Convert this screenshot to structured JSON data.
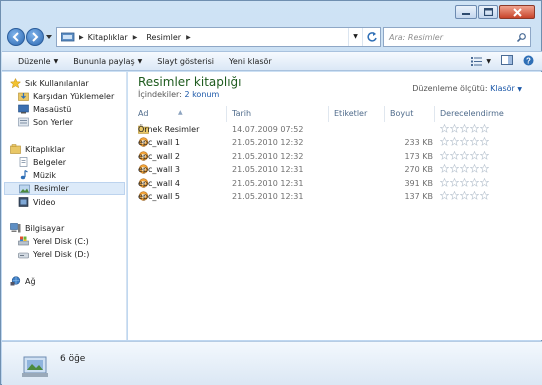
{
  "window": {
    "title": ""
  },
  "address": {
    "crumbs": [
      "Kitaplıklar",
      "Resimler"
    ],
    "search_placeholder": "Ara: Resimler"
  },
  "toolbar": {
    "organize": "Düzenle",
    "share": "Bununla paylaş",
    "slideshow": "Slayt gösterisi",
    "new_folder": "Yeni klasör"
  },
  "sidebar": {
    "favorites_header": "Sık Kullanılanlar",
    "favorites": [
      "Karşıdan Yüklemeler",
      "Masaüstü",
      "Son Yerler"
    ],
    "libraries_header": "Kitaplıklar",
    "libraries": [
      "Belgeler",
      "Müzik",
      "Resimler",
      "Video"
    ],
    "computer_header": "Bilgisayar",
    "drives": [
      "Yerel Disk (C:)",
      "Yerel Disk (D:)"
    ],
    "network": "Ağ"
  },
  "library": {
    "title": "Resimler kitaplığı",
    "includes_label": "İçindekiler:",
    "includes_link": "2 konum",
    "arrange_label": "Düzenleme ölçütü:",
    "arrange_value": "Klasör"
  },
  "columns": [
    "Ad",
    "Tarih",
    "Etiketler",
    "Boyut",
    "Derecelendirme"
  ],
  "files": [
    {
      "name": "Örnek Resimler",
      "date": "14.07.2009 07:52",
      "size": "",
      "type": "folder",
      "rating": 0
    },
    {
      "name": "epc_wall 1",
      "date": "21.05.2010 12:32",
      "size": "233 KB",
      "type": "image",
      "rating": 0
    },
    {
      "name": "epc_wall 2",
      "date": "21.05.2010 12:32",
      "size": "173 KB",
      "type": "image",
      "rating": 0
    },
    {
      "name": "epc_wall 3",
      "date": "21.05.2010 12:31",
      "size": "270 KB",
      "type": "image",
      "rating": 0
    },
    {
      "name": "epc_wall 4",
      "date": "21.05.2010 12:31",
      "size": "391 KB",
      "type": "image",
      "rating": 0
    },
    {
      "name": "epc_wall 5",
      "date": "21.05.2010 12:31",
      "size": "137 KB",
      "type": "image",
      "rating": 0
    }
  ],
  "status": {
    "count": "6 öğe"
  },
  "colors": {
    "title_green": "#1e5b1e",
    "link_blue": "#1a57a8",
    "selection": "#dceaf9"
  }
}
